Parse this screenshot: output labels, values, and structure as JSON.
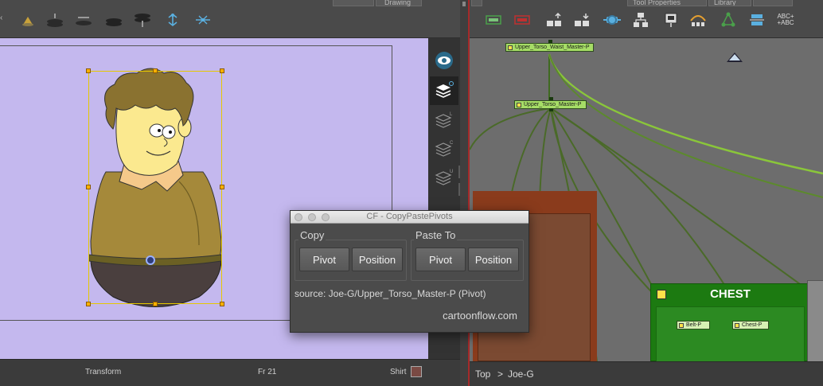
{
  "camera": {
    "tab1": "",
    "tab2": "Drawing",
    "status": {
      "mode": "Transform",
      "frame": "Fr 21",
      "drawing": "Shirt"
    },
    "toolbar_icons": [
      "light-icon",
      "layer-stack-icon",
      "layer-flat-icon",
      "layer-dark-icon",
      "layer-split-icon",
      "bone-up-icon",
      "bone-spread-icon"
    ],
    "side_icons": [
      "eye-icon",
      "layers-o-icon",
      "layers-l-icon",
      "layers-c-icon",
      "layers-u-icon"
    ]
  },
  "node_view": {
    "tabs": [
      "Tool Properties",
      "Library"
    ],
    "toolbar_icons": [
      "display-node-icon",
      "composite-node-icon",
      "add-node-icon",
      "remove-node-icon",
      "peg-icon",
      "group-icon",
      "backdrop-icon",
      "cutter-icon",
      "tree-icon",
      "link-icon",
      "abc-icon"
    ],
    "nodes": {
      "waist": "Upper_Torso_Waist_Master-P",
      "torso": "Upper_Torso_Master-P",
      "belt": "Belt-P",
      "chest_peg": "Chest-P"
    },
    "backdrops": {
      "chest": "CHEST"
    },
    "breadcrumb": {
      "top": "Top",
      "separator": ">",
      "current": "Joe-G"
    }
  },
  "dialog": {
    "title": "CF - CopyPastePivots",
    "copy_group": "Copy",
    "paste_group": "Paste To",
    "copy_pivot": "Pivot",
    "copy_position": "Position",
    "paste_pivot": "Pivot",
    "paste_position": "Position",
    "source": "source: Joe-G/Upper_Torso_Master-P (Pivot)",
    "link": "cartoonflow.com"
  },
  "colors": {
    "camera_bg": "#c4b8ee",
    "chest_backdrop": "#1c7a11",
    "node_accent": "#a6dd66",
    "selection": "#ffb000"
  }
}
